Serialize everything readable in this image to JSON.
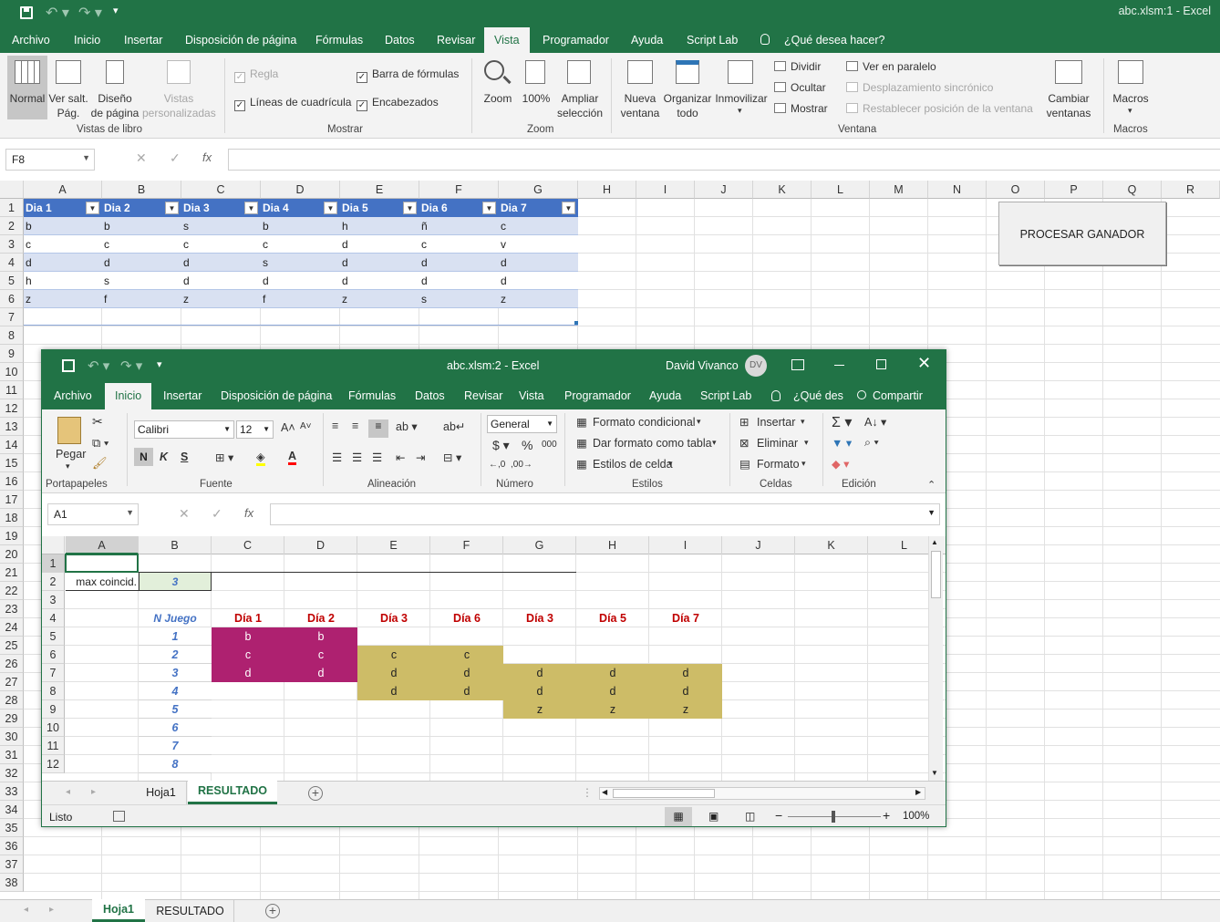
{
  "app": {
    "title": "abc.xlsm:1  -  Excel"
  },
  "tabs": [
    "Archivo",
    "Inicio",
    "Insertar",
    "Disposición de página",
    "Fórmulas",
    "Datos",
    "Revisar",
    "Vista",
    "Programador",
    "Ayuda",
    "Script Lab",
    "¿Qué desea hacer?"
  ],
  "ribbon": {
    "views": {
      "normal": "Normal",
      "page_break": "Ver salt.\nPág.",
      "page_layout": "Diseño\nde página",
      "custom": "Vistas\npersonalizadas",
      "group": "Vistas de libro"
    },
    "show": {
      "ruler": "Regla",
      "formula_bar": "Barra de fórmulas",
      "gridlines": "Líneas de cuadrícula",
      "headings": "Encabezados",
      "group": "Mostrar"
    },
    "zoom": {
      "zoom": "Zoom",
      "hundred": "100%",
      "selection": "Ampliar\nselección",
      "group": "Zoom"
    },
    "window": {
      "new": "Nueva\nventana",
      "arrange": "Organizar\ntodo",
      "freeze": "Inmovilizar",
      "split": "Dividir",
      "hide": "Ocultar",
      "unhide": "Mostrar",
      "side": "Ver en paralelo",
      "sync": "Desplazamiento sincrónico",
      "reset": "Restablecer posición de la ventana",
      "switch": "Cambiar\nventanas",
      "group": "Ventana"
    },
    "macros": {
      "macros": "Macros",
      "group": "Macros"
    }
  },
  "namebox": "F8",
  "columns": [
    "A",
    "B",
    "C",
    "D",
    "E",
    "F",
    "G",
    "H",
    "I",
    "J",
    "K",
    "L",
    "M",
    "N",
    "O",
    "P",
    "Q",
    "R"
  ],
  "rows": [
    "1",
    "2",
    "3",
    "4",
    "5",
    "6",
    "7",
    "8",
    "9",
    "10",
    "11",
    "12",
    "13",
    "14",
    "15",
    "16",
    "17",
    "18",
    "19",
    "20",
    "21",
    "22",
    "23",
    "24",
    "25",
    "26",
    "27",
    "28",
    "29",
    "30",
    "31",
    "32",
    "33",
    "34",
    "35",
    "36",
    "37",
    "38"
  ],
  "table": {
    "headers": [
      "Dia 1",
      "Dia 2",
      "Dia 3",
      "Dia 4",
      "Dia 5",
      "Dia 6",
      "Dia 7"
    ],
    "rows": [
      [
        "b",
        "b",
        "s",
        "b",
        "h",
        "ñ",
        "c"
      ],
      [
        "c",
        "c",
        "c",
        "c",
        "d",
        "c",
        "v"
      ],
      [
        "d",
        "d",
        "d",
        "s",
        "d",
        "d",
        "d"
      ],
      [
        "h",
        "s",
        "d",
        "d",
        "d",
        "d",
        "d"
      ],
      [
        "z",
        "f",
        "z",
        "f",
        "z",
        "s",
        "z"
      ]
    ]
  },
  "process_button": "PROCESAR GANADOR",
  "sheets": [
    "Hoja1",
    "RESULTADO"
  ],
  "w2": {
    "title": "abc.xlsm:2  -  Excel",
    "user": "David Vivanco",
    "initials": "DV",
    "tabs": [
      "Archivo",
      "Inicio",
      "Insertar",
      "Disposición de página",
      "Fórmulas",
      "Datos",
      "Revisar",
      "Vista",
      "Programador",
      "Ayuda",
      "Script Lab",
      "¿Qué des",
      "Compartir"
    ],
    "ribbon": {
      "paste": "Pegar",
      "font": "Calibri",
      "size": "12",
      "bold": "N",
      "italic": "K",
      "underline": "S",
      "number_format": "General",
      "cond_format": "Formato condicional",
      "format_table": "Dar formato como tabla",
      "cell_styles": "Estilos de celda",
      "insert": "Insertar",
      "delete": "Eliminar",
      "format": "Formato",
      "groups": [
        "Portapapeles",
        "Fuente",
        "Alineación",
        "Número",
        "Estilos",
        "Celdas",
        "Edición"
      ]
    },
    "namebox": "A1",
    "columns": [
      "A",
      "B",
      "C",
      "D",
      "E",
      "F",
      "G",
      "H",
      "I",
      "J",
      "K",
      "L"
    ],
    "rows": [
      "1",
      "2",
      "3",
      "4",
      "5",
      "6",
      "7",
      "8",
      "9",
      "10",
      "11",
      "12"
    ],
    "max_label": "max coincid.",
    "max_value": "3",
    "n_juego": "N Juego",
    "headers": [
      "Día 1",
      "Día 2",
      "Día 3",
      "Día 6",
      "Día 3",
      "Día 5",
      "Día 7"
    ],
    "games": [
      "1",
      "2",
      "3",
      "4",
      "5",
      "6",
      "7",
      "8"
    ],
    "grid": [
      [
        "b",
        "b",
        "",
        "",
        "",
        "",
        ""
      ],
      [
        "c",
        "c",
        "c",
        "c",
        "",
        "",
        ""
      ],
      [
        "d",
        "d",
        "d",
        "d",
        "d",
        "d",
        "d"
      ],
      [
        "",
        "",
        "d",
        "d",
        "d",
        "d",
        "d"
      ],
      [
        "",
        "",
        "",
        "",
        "z",
        "z",
        "z"
      ]
    ],
    "sheets": [
      "Hoja1",
      "RESULTADO"
    ],
    "status": "Listo",
    "zoom": "100%",
    "colors": {
      "magenta": "#ae2170",
      "olive": "#cdbc67"
    }
  }
}
